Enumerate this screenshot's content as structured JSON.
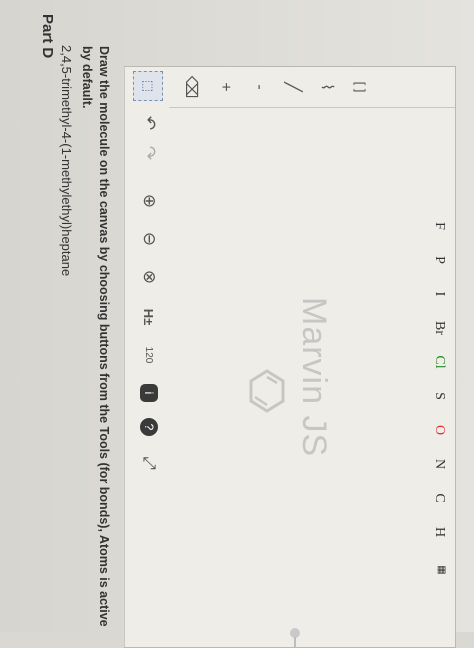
{
  "part": {
    "title": "Part D"
  },
  "molecule": {
    "name": "2,4,5-trimethyl-4-(1-methylethyl)heptane"
  },
  "instructions": {
    "text": "Draw the molecule on the canvas by choosing buttons from the Tools (for bonds), Atoms is active by default."
  },
  "toolbar": {
    "undo": "↶",
    "redo": "↷",
    "zoom_in": "⊕",
    "zoom_out": "⊖",
    "clear": "⊗",
    "hydrogen": "H±",
    "isotope": "120",
    "info": "i",
    "help": "?",
    "expand": "⤢"
  },
  "left_tools": {
    "select_label": "⬚",
    "erase": "⌫",
    "plus": "+",
    "minus": "-",
    "bond": "╱",
    "chain": "⌇",
    "bracket": "[ ]"
  },
  "atoms": [
    "H",
    "C",
    "N",
    "O",
    "S",
    "Cl",
    "Br",
    "I",
    "P",
    "F"
  ],
  "watermark": {
    "text": "Marvin JS"
  }
}
